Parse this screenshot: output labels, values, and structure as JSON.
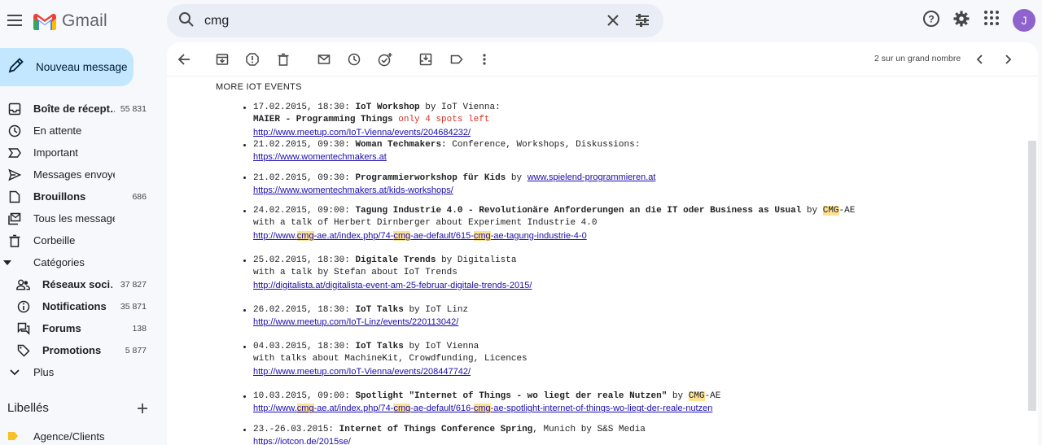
{
  "app": {
    "name": "Gmail"
  },
  "search": {
    "query": "cmg"
  },
  "compose": {
    "label": "Nouveau message"
  },
  "avatar": {
    "initial": "J"
  },
  "nav": [
    {
      "name": "inbox",
      "label": "Boîte de récept…",
      "count": "55 831",
      "icon": "inbox-icon",
      "bold": true
    },
    {
      "name": "snoozed",
      "label": "En attente",
      "count": "",
      "icon": "clock-icon"
    },
    {
      "name": "important",
      "label": "Important",
      "count": "",
      "icon": "important-icon"
    },
    {
      "name": "sent",
      "label": "Messages envoyés",
      "count": "",
      "icon": "send-icon"
    },
    {
      "name": "drafts",
      "label": "Brouillons",
      "count": "686",
      "icon": "draft-icon",
      "bold": true
    },
    {
      "name": "all-mail",
      "label": "Tous les messages",
      "count": "",
      "icon": "all-mail-icon"
    },
    {
      "name": "trash",
      "label": "Corbeille",
      "count": "",
      "icon": "trash-icon"
    },
    {
      "name": "categories",
      "label": "Catégories",
      "count": "",
      "icon": "caret-down-icon"
    },
    {
      "name": "social",
      "label": "Réseaux soci…",
      "count": "37 827",
      "icon": "people-icon",
      "bold": true,
      "sub": true
    },
    {
      "name": "updates",
      "label": "Notifications",
      "count": "35 871",
      "icon": "info-icon",
      "bold": true,
      "sub": true
    },
    {
      "name": "forums",
      "label": "Forums",
      "count": "138",
      "icon": "forum-icon",
      "bold": true,
      "sub": true
    },
    {
      "name": "promotions",
      "label": "Promotions",
      "count": "5 877",
      "icon": "tag-icon",
      "bold": true,
      "sub": true
    },
    {
      "name": "more",
      "label": "Plus",
      "count": "",
      "icon": "chevron-down-icon"
    }
  ],
  "labels": {
    "title": "Libellés",
    "items": [
      {
        "label": "Agence/Clients",
        "color": "#f6c026"
      }
    ]
  },
  "pager": {
    "text": "2 sur un grand nombre"
  },
  "email": {
    "section_title": "MORE IOT EVENTS",
    "events": [
      {
        "date": "17.02.2015, 18:30:",
        "title": "IoT Workshop",
        "by": " by IoT Vienna:",
        "line2_bold": "MAIER - Programming Things",
        "line2_red": " only 4 spots left",
        "url": "http://www.meetup.com/IoT-Vienna/events/204684232/"
      },
      {
        "date": "21.02.2015, 09:30:",
        "title": "Woman Techmakers:",
        "by": " Conference, Workshops, Diskussions:",
        "url": "https://www.womentechmakers.at"
      },
      {
        "date": "21.02.2015, 09:30:",
        "title": "Programmierworkshop für Kids",
        "by": " by ",
        "inline_url": "www.spielend-programmieren.at",
        "url": "https://www.womentechmakers.at/kids-workshops/"
      },
      {
        "date": "24.02.2015, 09:00:",
        "title": "Tagung Industrie 4.0 - Revolutionäre Anforderungen an die IT oder Business as Usual",
        "by": " by ",
        "org_hl": "CMG",
        "org_rest": "-AE",
        "line2": "with a talk of Herbert Dirnberger about Experiment Industrie 4.0",
        "url_parts": [
          "http://www.",
          "cmg",
          "-ae.at/index.php/74-",
          "cmg",
          "-ae-default/615-",
          "cmg",
          "-ae-tagung-industrie-4-0"
        ]
      },
      {
        "date": "25.02.2015, 18:30:",
        "title": "Digitale Trends",
        "by": " by Digitalista",
        "line2": "with a talk by Stefan about IoT Trends",
        "url": "http://digitalista.at/digitalista-event-am-25-februar-digitale-trends-2015/ "
      },
      {
        "date": "26.02.2015, 18:30:",
        "title": "IoT Talks",
        "by": " by IoT Linz",
        "url": "http://www.meetup.com/IoT-Linz/events/220113042/"
      },
      {
        "date": "04.03.2015, 18:30:",
        "title": "IoT Talks",
        "by": " by IoT Vienna",
        "line2": "with talks about MachineKit, Crowdfunding, Licences",
        "url": "http://www.meetup.com/IoT-Vienna/events/208447742/ "
      },
      {
        "date": "10.03.2015, 09:00:",
        "title": "Spotlight \"Internet of Things - wo liegt der reale Nutzen\"",
        "by": " by ",
        "org_hl": "CMG",
        "org_rest": "-AE",
        "url_parts": [
          "http://www.",
          "cmg",
          "-ae.at/index.php/74-",
          "cmg",
          "-ae-default/616-",
          "cmg",
          "-ae-spotlight-internet-of-things-wo-liegt-der-reale-nutzen "
        ]
      },
      {
        "date": "23.-26.03.2015:",
        "title": "Internet of Things Conference Spring",
        "by": ", Munich by S&S Media",
        "url": "https://iotcon.de/2015se/"
      }
    ]
  }
}
